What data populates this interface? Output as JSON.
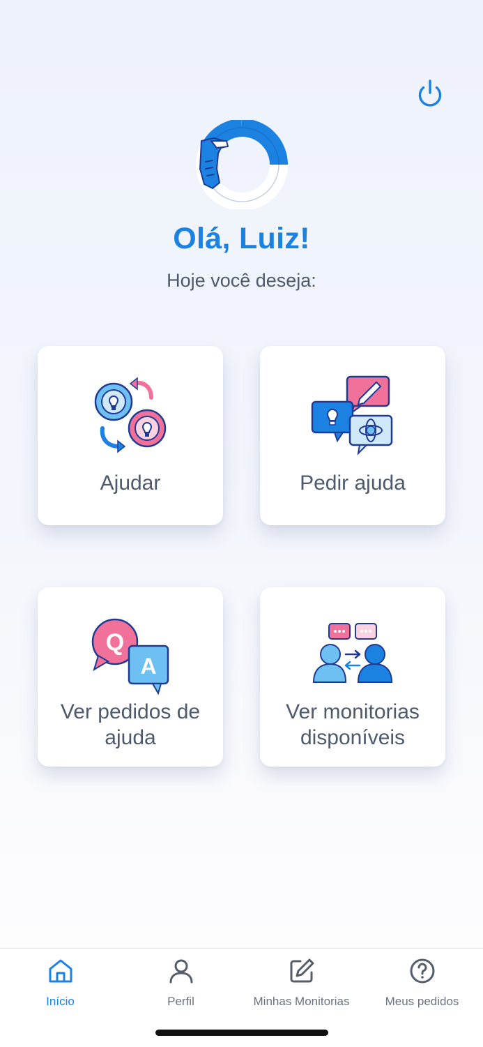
{
  "header": {
    "greeting": "Olá, Luiz!",
    "subtitle": "Hoje você deseja:"
  },
  "icons": {
    "power": "power-icon",
    "logo": "helping-hand-ring-logo"
  },
  "cards": [
    {
      "label": "Ajudar",
      "icon": "lightbulb-exchange-icon"
    },
    {
      "label": "Pedir ajuda",
      "icon": "chat-bubbles-ideas-icon"
    },
    {
      "label": "Ver pedidos de ajuda",
      "icon": "qa-bubbles-icon"
    },
    {
      "label": "Ver monitorias disponíveis",
      "icon": "people-conversation-icon"
    }
  ],
  "tabs": [
    {
      "label": "Início",
      "icon": "home-icon",
      "active": true
    },
    {
      "label": "Perfil",
      "icon": "user-icon",
      "active": false
    },
    {
      "label": "Minhas Monitorias",
      "icon": "edit-icon",
      "active": false
    },
    {
      "label": "Meus pedidos",
      "icon": "help-circle-icon",
      "active": false
    }
  ],
  "colors": {
    "accent": "#1b82e2",
    "text": "#4e5a6b",
    "tab_inactive": "#6b7380",
    "pink": "#f0719a",
    "light_blue": "#6ec0f2",
    "navy": "#1f3a93"
  }
}
